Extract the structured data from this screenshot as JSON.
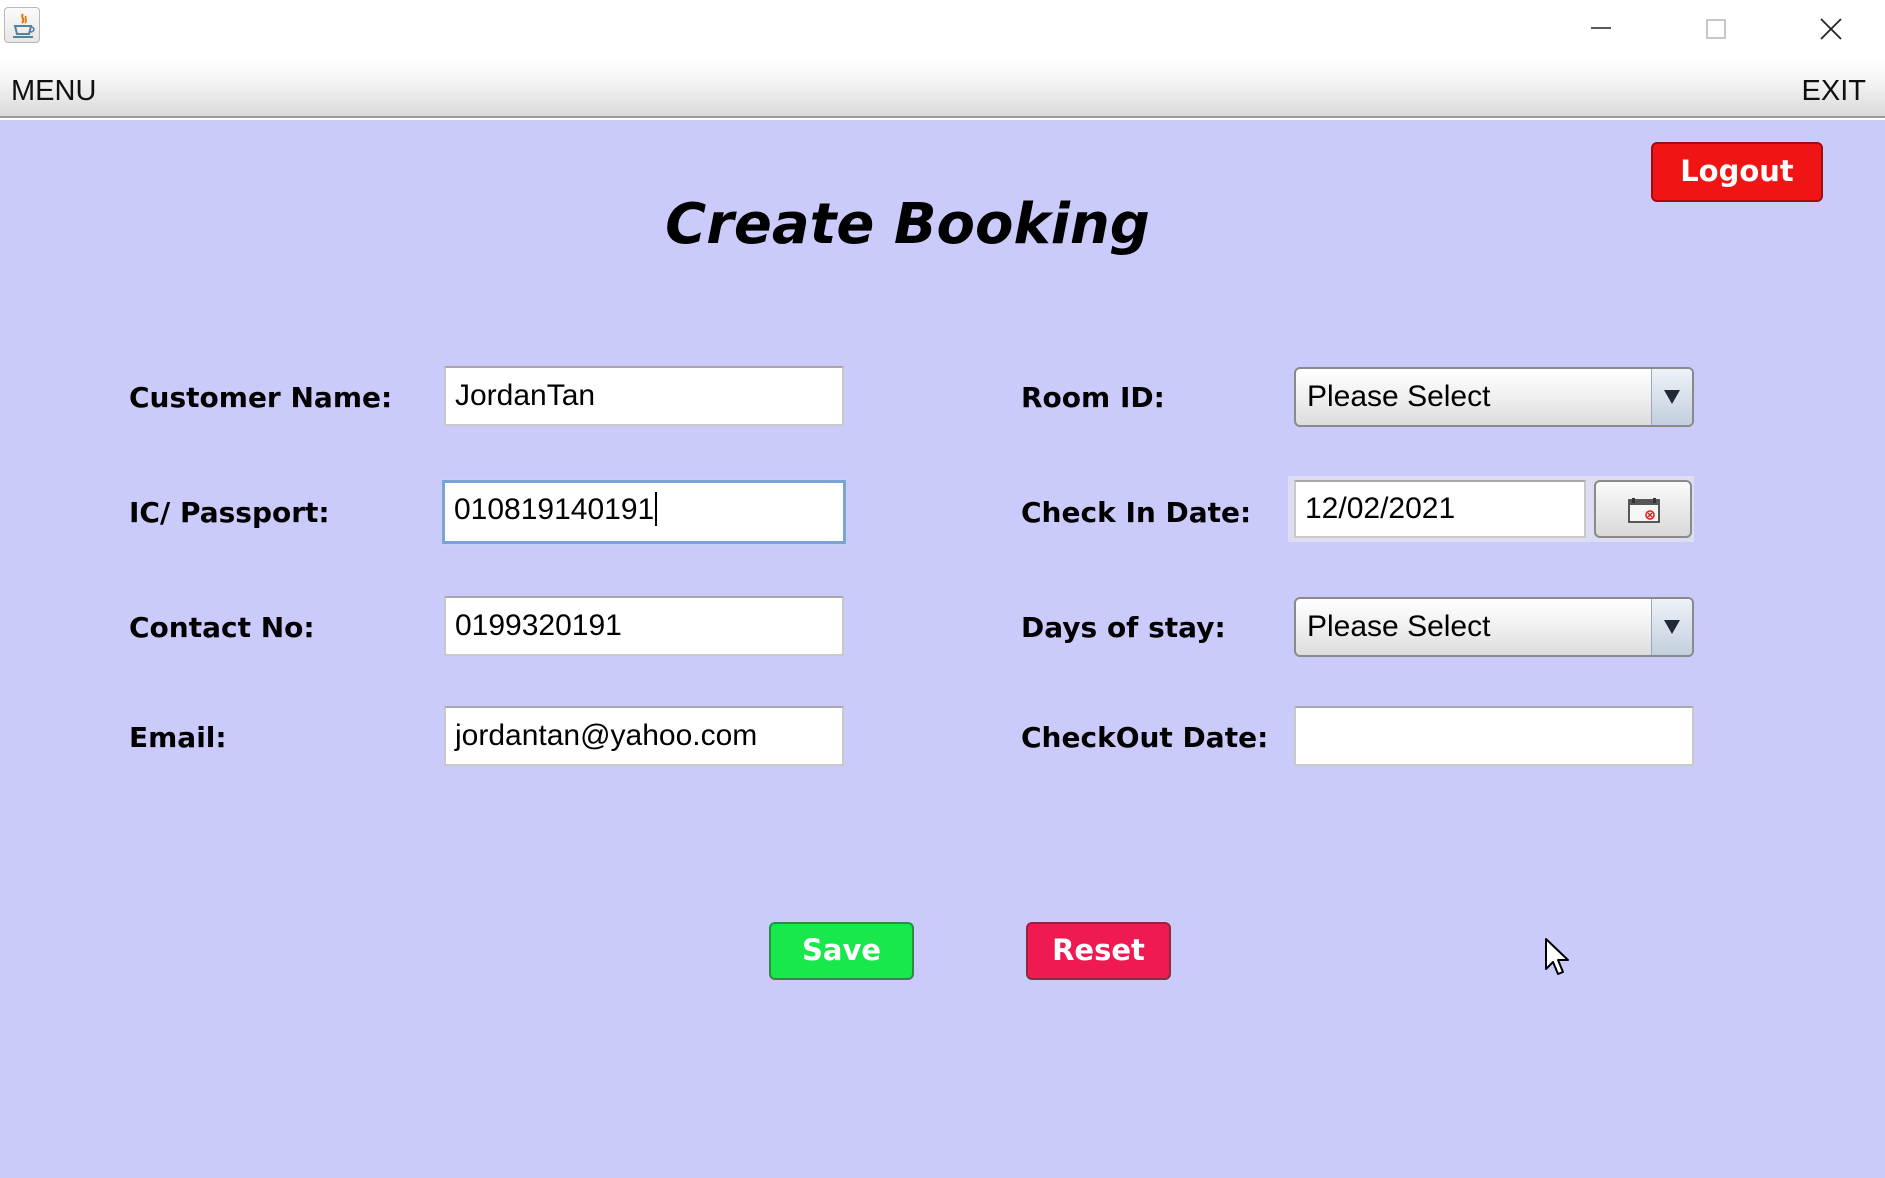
{
  "menubar": {
    "menu_label": "MENU",
    "exit_label": "EXIT"
  },
  "page": {
    "title": "Create Booking",
    "logout_label": "Logout"
  },
  "form": {
    "customer_name": {
      "label": "Customer Name:",
      "value": "JordanTan"
    },
    "ic_passport": {
      "label": "IC/ Passport:",
      "value": "010819140191"
    },
    "contact_no": {
      "label": "Contact No:",
      "value": "0199320191"
    },
    "email": {
      "label": "Email:",
      "value": "jordantan@yahoo.com"
    },
    "room_id": {
      "label": "Room ID:",
      "selected": "Please Select"
    },
    "check_in_date": {
      "label": "Check In Date:",
      "value": "12/02/2021"
    },
    "days_of_stay": {
      "label": "Days of stay:",
      "selected": "Please Select"
    },
    "checkout_date": {
      "label": "CheckOut Date:",
      "value": ""
    }
  },
  "actions": {
    "save_label": "Save",
    "reset_label": "Reset"
  },
  "colors": {
    "background": "#cbcbfb",
    "logout": "#f01414",
    "save": "#19e84d",
    "reset": "#ef1a52"
  }
}
